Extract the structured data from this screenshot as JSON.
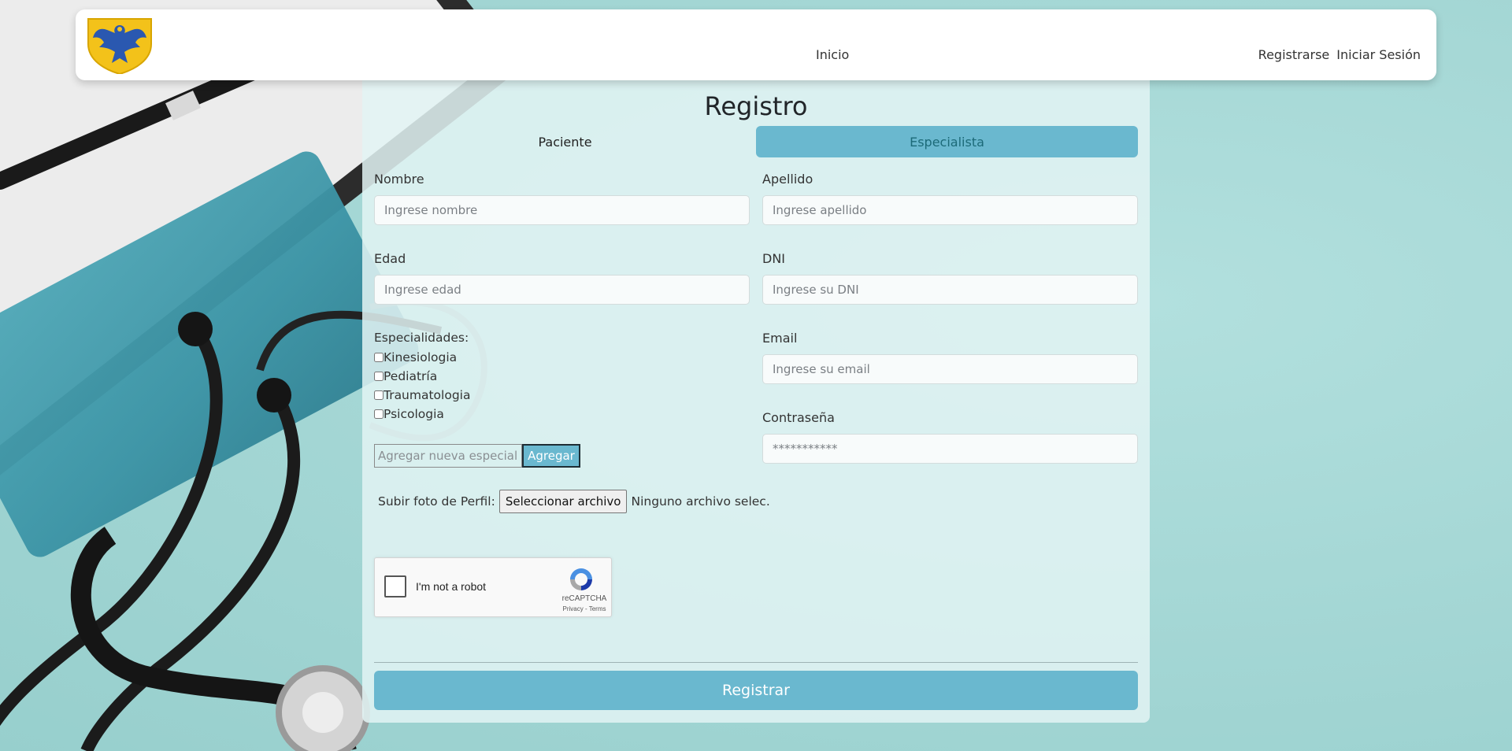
{
  "navbar": {
    "logo_icon": "eagle-shield-logo",
    "home_link": "Inicio",
    "register_link": "Registrarse",
    "login_link": "Iniciar Sesión"
  },
  "form": {
    "title": "Registro",
    "tabs": [
      {
        "label": "Paciente",
        "active": false
      },
      {
        "label": "Especialista",
        "active": true
      }
    ],
    "fields": {
      "nombre": {
        "label": "Nombre",
        "placeholder": "Ingrese nombre",
        "value": ""
      },
      "apellido": {
        "label": "Apellido",
        "placeholder": "Ingrese apellido",
        "value": ""
      },
      "edad": {
        "label": "Edad",
        "placeholder": "Ingrese edad",
        "value": ""
      },
      "dni": {
        "label": "DNI",
        "placeholder": "Ingrese su DNI",
        "value": ""
      },
      "email": {
        "label": "Email",
        "placeholder": "Ingrese su email",
        "value": ""
      },
      "password": {
        "label": "Contraseña",
        "placeholder": "***********",
        "value": ""
      }
    },
    "specialties": {
      "title": "Especialidades:",
      "items": [
        {
          "label": "Kinesiologia",
          "checked": false
        },
        {
          "label": "Pediatría",
          "checked": false
        },
        {
          "label": "Traumatologia",
          "checked": false
        },
        {
          "label": "Psicologia",
          "checked": false
        }
      ],
      "add_placeholder": "Agregar nueva especialidad",
      "add_button": "Agregar"
    },
    "photo": {
      "label": "Subir foto de Perfil:",
      "button": "Seleccionar archivo",
      "status": "Ninguno archivo selec."
    },
    "captcha": {
      "checkbox_label": "I'm not a robot",
      "brand": "reCAPTCHA",
      "links": "Privacy - Terms"
    },
    "submit_label": "Registrar"
  },
  "colors": {
    "accent": "#6ab8cf",
    "background": "#a9d9d8",
    "panel": "#e2f3f3",
    "tab_active_text": "#1c6a78"
  }
}
